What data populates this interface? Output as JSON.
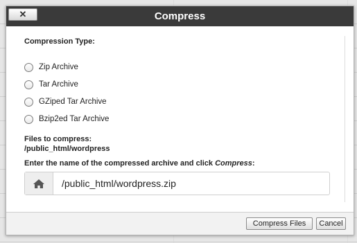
{
  "dialog": {
    "title": "Compress",
    "close_symbol": "✕",
    "compression_type_label": "Compression Type:",
    "options": [
      {
        "label": "Zip Archive",
        "selected": false
      },
      {
        "label": "Tar Archive",
        "selected": false
      },
      {
        "label": "GZiped Tar Archive",
        "selected": false
      },
      {
        "label": "Bzip2ed Tar Archive",
        "selected": false
      }
    ],
    "files_label": "Files to compress:",
    "files_value": "/public_html/wordpress",
    "instruction_prefix": "Enter the name of the compressed archive and click ",
    "instruction_emphasis": "Compress",
    "instruction_suffix": ":",
    "archive_name": "/public_html/wordpress.zip",
    "addon_icon": "home-icon",
    "buttons": {
      "compress": "Compress Files",
      "cancel": "Cancel"
    }
  }
}
